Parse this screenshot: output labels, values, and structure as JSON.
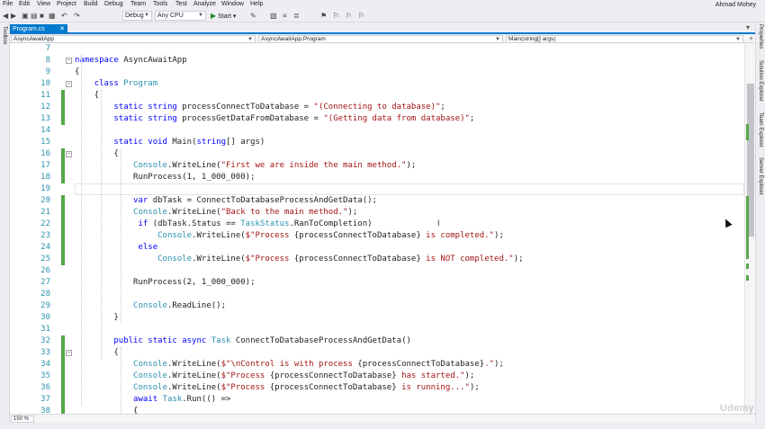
{
  "menu": {
    "items": [
      "File",
      "Edit",
      "View",
      "Project",
      "Build",
      "Debug",
      "Team",
      "Tools",
      "Test",
      "Analyze",
      "Window",
      "Help"
    ],
    "user": "Ahmad Mohey"
  },
  "toolbar": {
    "configuration": "Debug",
    "platform": "Any CPU",
    "start_label": "Start"
  },
  "side_panels": {
    "left": "Toolbox",
    "right": [
      "Properties",
      "Solution Explorer",
      "Team Explorer",
      "Server Explorer"
    ]
  },
  "document_tab": {
    "label": "Program.cs"
  },
  "navbar": {
    "project": "AsyncAwaitApp",
    "type": "AsyncAwaitApp.Program",
    "member": "Main(string[] args)"
  },
  "editor": {
    "line_numbers": [
      "7",
      "8",
      "9",
      "10",
      "11",
      "12",
      "13",
      "14",
      "15",
      "16",
      "17",
      "18",
      "19",
      "20",
      "21",
      "22",
      "23",
      "24",
      "25",
      "26",
      "27",
      "28",
      "29",
      "30",
      "31",
      "32",
      "33",
      "34",
      "35",
      "36",
      "37",
      "38"
    ],
    "lines": [
      [],
      [
        {
          "t": "namespace ",
          "c": "kw"
        },
        {
          "t": "AsyncAwaitApp"
        }
      ],
      [
        {
          "t": "{"
        }
      ],
      [
        {
          "t": "    "
        },
        {
          "t": "class ",
          "c": "kw"
        },
        {
          "t": "Program",
          "c": "ty"
        }
      ],
      [
        {
          "t": "    {"
        }
      ],
      [
        {
          "t": "        "
        },
        {
          "t": "static string ",
          "c": "kw"
        },
        {
          "t": "processConnectToDatabase = "
        },
        {
          "t": "\"(Connecting to database)\"",
          "c": "st"
        },
        {
          "t": ";"
        }
      ],
      [
        {
          "t": "        "
        },
        {
          "t": "static string ",
          "c": "kw"
        },
        {
          "t": "processGetDataFromDatabase = "
        },
        {
          "t": "\"(Getting data from database)\"",
          "c": "st"
        },
        {
          "t": ";"
        }
      ],
      [],
      [
        {
          "t": "        "
        },
        {
          "t": "static void ",
          "c": "kw"
        },
        {
          "t": "Main("
        },
        {
          "t": "string",
          "c": "kw"
        },
        {
          "t": "[] args)"
        }
      ],
      [
        {
          "t": "        {"
        }
      ],
      [
        {
          "t": "            "
        },
        {
          "t": "Console",
          "c": "ty"
        },
        {
          "t": ".WriteLine("
        },
        {
          "t": "\"First we are inside the main method.\"",
          "c": "st"
        },
        {
          "t": ");"
        }
      ],
      [
        {
          "t": "            RunProcess(1, 1_000_000);"
        }
      ],
      [],
      [
        {
          "t": "            "
        },
        {
          "t": "var ",
          "c": "kw"
        },
        {
          "t": "dbTask = ConnectToDatabaseProcessAndGetData();"
        }
      ],
      [
        {
          "t": "            "
        },
        {
          "t": "Console",
          "c": "ty"
        },
        {
          "t": ".WriteLine("
        },
        {
          "t": "\"Back to the main method.\"",
          "c": "st"
        },
        {
          "t": ");"
        }
      ],
      [
        {
          "t": "             "
        },
        {
          "t": "if ",
          "c": "kw"
        },
        {
          "t": "(dbTask.Status == "
        },
        {
          "t": "TaskStatus",
          "c": "ty"
        },
        {
          "t": ".RanToCompletion)"
        }
      ],
      [
        {
          "t": "                 "
        },
        {
          "t": "Console",
          "c": "ty"
        },
        {
          "t": ".WriteLine("
        },
        {
          "t": "$\"Process ",
          "c": "st"
        },
        {
          "t": "{processConnectToDatabase}"
        },
        {
          "t": " is completed.\"",
          "c": "st"
        },
        {
          "t": ");"
        }
      ],
      [
        {
          "t": "             "
        },
        {
          "t": "else",
          "c": "kw"
        }
      ],
      [
        {
          "t": "                 "
        },
        {
          "t": "Console",
          "c": "ty"
        },
        {
          "t": ".WriteLine("
        },
        {
          "t": "$\"Process ",
          "c": "st"
        },
        {
          "t": "{processConnectToDatabase}"
        },
        {
          "t": " is NOT completed.\"",
          "c": "st"
        },
        {
          "t": ");"
        }
      ],
      [],
      [
        {
          "t": "            RunProcess(2, 1_000_000);"
        }
      ],
      [],
      [
        {
          "t": "            "
        },
        {
          "t": "Console",
          "c": "ty"
        },
        {
          "t": ".ReadLine();"
        }
      ],
      [
        {
          "t": "        }"
        }
      ],
      [],
      [
        {
          "t": "        "
        },
        {
          "t": "public static async ",
          "c": "kw"
        },
        {
          "t": "Task",
          "c": "ty"
        },
        {
          "t": " ConnectToDatabaseProcessAndGetData()"
        }
      ],
      [
        {
          "t": "        {"
        }
      ],
      [
        {
          "t": "            "
        },
        {
          "t": "Console",
          "c": "ty"
        },
        {
          "t": ".WriteLine("
        },
        {
          "t": "$\"\\nControl is with process ",
          "c": "st"
        },
        {
          "t": "{processConnectToDatabase}"
        },
        {
          "t": ".\"",
          "c": "st"
        },
        {
          "t": ");"
        }
      ],
      [
        {
          "t": "            "
        },
        {
          "t": "Console",
          "c": "ty"
        },
        {
          "t": ".WriteLine("
        },
        {
          "t": "$\"Process ",
          "c": "st"
        },
        {
          "t": "{processConnectToDatabase}"
        },
        {
          "t": " has started.\"",
          "c": "st"
        },
        {
          "t": ");"
        }
      ],
      [
        {
          "t": "            "
        },
        {
          "t": "Console",
          "c": "ty"
        },
        {
          "t": ".WriteLine("
        },
        {
          "t": "$\"Process ",
          "c": "st"
        },
        {
          "t": "{processConnectToDatabase}"
        },
        {
          "t": " is running...\"",
          "c": "st"
        },
        {
          "t": ");"
        }
      ],
      [
        {
          "t": "            "
        },
        {
          "t": "await ",
          "c": "kw"
        },
        {
          "t": "Task",
          "c": "ty"
        },
        {
          "t": ".Run(() =>"
        }
      ],
      [
        {
          "t": "            {"
        }
      ]
    ],
    "changed_lines": [
      "11",
      "12",
      "13",
      "16",
      "17",
      "18",
      "20",
      "21",
      "22",
      "23",
      "24",
      "25",
      "32",
      "33",
      "34",
      "35",
      "36",
      "37",
      "38"
    ],
    "fold_lines": [
      "8",
      "10",
      "16",
      "33"
    ]
  },
  "bottom": {
    "zoom": "150 %",
    "watermark": "Udemy"
  },
  "colors": {
    "accent": "#007acc",
    "keyword": "#0000ff",
    "type": "#2b91af",
    "string": "#a31515",
    "change": "#57a64a"
  }
}
